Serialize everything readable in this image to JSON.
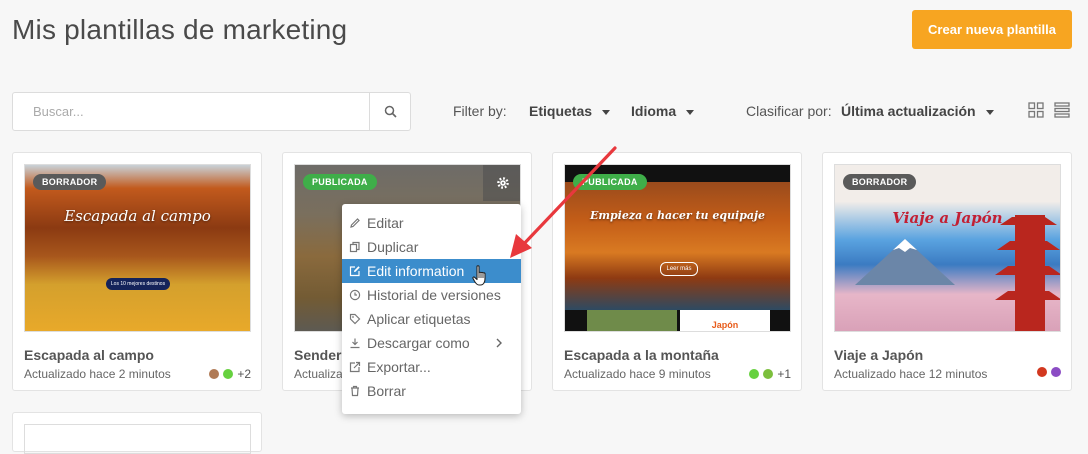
{
  "header": {
    "title": "Mis plantillas de marketing",
    "create_label": "Crear nueva plantilla"
  },
  "search": {
    "placeholder": "Buscar..."
  },
  "filters": {
    "label": "Filter by:",
    "tags": "Etiquetas",
    "language": "Idioma"
  },
  "sort": {
    "label": "Clasificar por:",
    "value": "Última actualización"
  },
  "cards": [
    {
      "status": "BORRADOR",
      "title": "Escapada al campo",
      "updated": "Actualizado hace 2 minutos",
      "thumb_title": "Escapada al campo",
      "thumb_button": "Los 10 mejores destinos",
      "tag_colors": [
        "#b07a55",
        "#66d13f"
      ],
      "more_tags": "+2"
    },
    {
      "status": "PUBLICADA",
      "title": "Senderis",
      "updated": "Actualiza"
    },
    {
      "status": "PUBLICADA",
      "title": "Escapada a la montaña",
      "updated": "Actualizado hace 9 minutos",
      "thumb_title": "Empieza a hacer tu equipaje",
      "thumb_button": "Leer más",
      "thumb_caption": "Japón",
      "tag_colors": [
        "#66d13f",
        "#7cbf3d"
      ],
      "more_tags": "+1"
    },
    {
      "status": "BORRADOR",
      "title": "Viaje a Japón",
      "updated": "Actualizado hace 12 minutos",
      "thumb_title": "Viaje a Japón",
      "tag_colors": [
        "#d2381f",
        "#8b4cc4"
      ]
    }
  ],
  "context_menu": {
    "items": [
      {
        "label": "Editar",
        "icon": "pencil-icon"
      },
      {
        "label": "Duplicar",
        "icon": "copy-icon"
      },
      {
        "label": "Edit information",
        "icon": "edit-box-icon",
        "active": true
      },
      {
        "label": "Historial de versiones",
        "icon": "clock-icon"
      },
      {
        "label": "Aplicar etiquetas",
        "icon": "tag-icon"
      },
      {
        "label": "Descargar como",
        "icon": "download-icon",
        "submenu": true
      },
      {
        "label": "Exportar...",
        "icon": "export-icon"
      },
      {
        "label": "Borrar",
        "icon": "trash-icon"
      }
    ]
  },
  "colors": {
    "accent": "#f7a521",
    "menu_active": "#3c8dcc",
    "annotation_arrow": "#e8383d",
    "published": "#3fae49",
    "draft": "#5a5a5a"
  }
}
